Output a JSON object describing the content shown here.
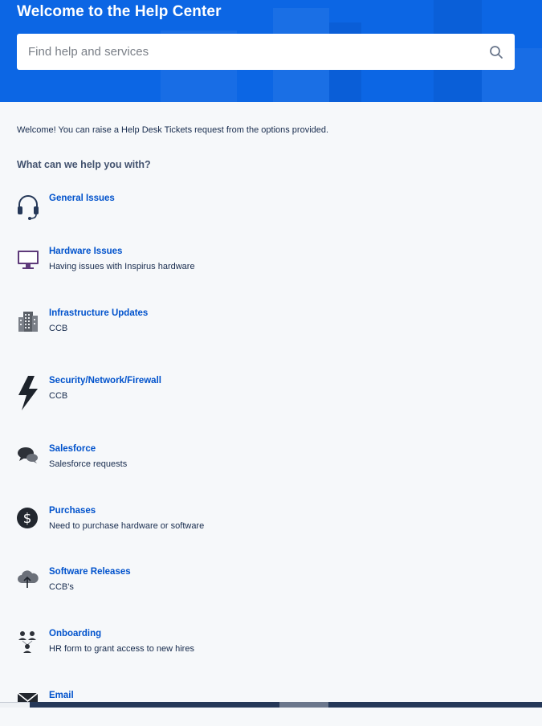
{
  "header": {
    "title": "Welcome to the Help Center",
    "search_placeholder": "Find help and services",
    "accent_color": "#0c66e4"
  },
  "main": {
    "intro": "Welcome! You can raise a Help Desk Tickets request from the options provided.",
    "question": "What can we help you with?",
    "link_color": "#0052cc",
    "request_types": [
      {
        "title": "General Issues",
        "description": "",
        "icon": "headset-icon"
      },
      {
        "title": "Hardware Issues",
        "description": "Having issues with Inspirus hardware",
        "icon": "monitor-icon"
      },
      {
        "title": "Infrastructure Updates",
        "description": "CCB",
        "icon": "building-icon"
      },
      {
        "title": "Security/Network/Firewall",
        "description": "CCB",
        "icon": "lightning-icon"
      },
      {
        "title": "Salesforce",
        "description": "Salesforce requests",
        "icon": "chat-bubbles-icon"
      },
      {
        "title": "Purchases",
        "description": "Need to purchase hardware or software",
        "icon": "dollar-icon"
      },
      {
        "title": "Software Releases",
        "description": "CCB's",
        "icon": "cloud-upload-icon"
      },
      {
        "title": "Onboarding",
        "description": "HR form to grant access to new hires",
        "icon": "people-icon"
      },
      {
        "title": "Email",
        "description": "",
        "icon": "envelope-icon"
      }
    ]
  }
}
